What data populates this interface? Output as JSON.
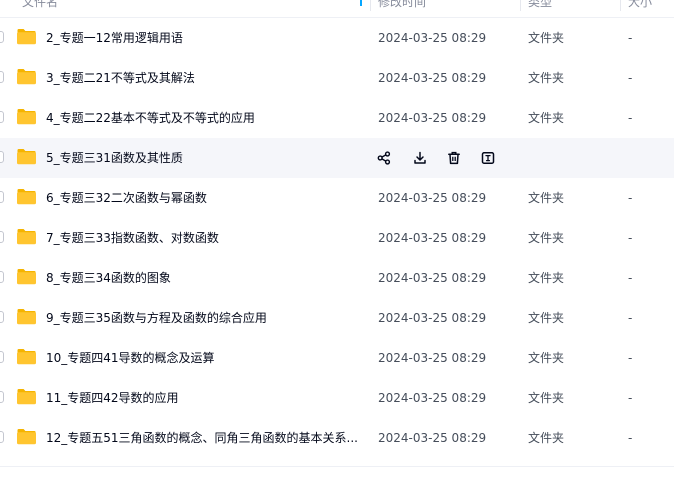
{
  "header": {
    "name": "文件名",
    "modified": "修改时间",
    "type": "类型",
    "size": "大小"
  },
  "colors": {
    "folder": "#ffc52f",
    "folder_dark": "#f5b400",
    "hover_row": "#f5f6fa",
    "sort_accent": "#06a7ff",
    "action_icon": "#03081a"
  },
  "hover_actions": [
    "share-icon",
    "download-icon",
    "delete-icon",
    "rename-icon"
  ],
  "rows": [
    {
      "name": "2_专题一12常用逻辑用语",
      "modified": "2024-03-25 08:29",
      "type": "文件夹",
      "size": "-"
    },
    {
      "name": "3_专题二21不等式及其解法",
      "modified": "2024-03-25 08:29",
      "type": "文件夹",
      "size": "-"
    },
    {
      "name": "4_专题二22基本不等式及不等式的应用",
      "modified": "2024-03-25 08:29",
      "type": "文件夹",
      "size": "-"
    },
    {
      "name": "5_专题三31函数及其性质",
      "modified": "",
      "type": "",
      "size": "",
      "hover": true
    },
    {
      "name": "6_专题三32二次函数与幂函数",
      "modified": "2024-03-25 08:29",
      "type": "文件夹",
      "size": "-"
    },
    {
      "name": "7_专题三33指数函数、对数函数",
      "modified": "2024-03-25 08:29",
      "type": "文件夹",
      "size": "-"
    },
    {
      "name": "8_专题三34函数的图象",
      "modified": "2024-03-25 08:29",
      "type": "文件夹",
      "size": "-"
    },
    {
      "name": "9_专题三35函数与方程及函数的综合应用",
      "modified": "2024-03-25 08:29",
      "type": "文件夹",
      "size": "-"
    },
    {
      "name": "10_专题四41导数的概念及运算",
      "modified": "2024-03-25 08:29",
      "type": "文件夹",
      "size": "-"
    },
    {
      "name": "11_专题四42导数的应用",
      "modified": "2024-03-25 08:29",
      "type": "文件夹",
      "size": "-"
    },
    {
      "name": "12_专题五51三角函数的概念、同角三角函数的基本关系...",
      "modified": "2024-03-25 08:29",
      "type": "文件夹",
      "size": "-"
    }
  ]
}
